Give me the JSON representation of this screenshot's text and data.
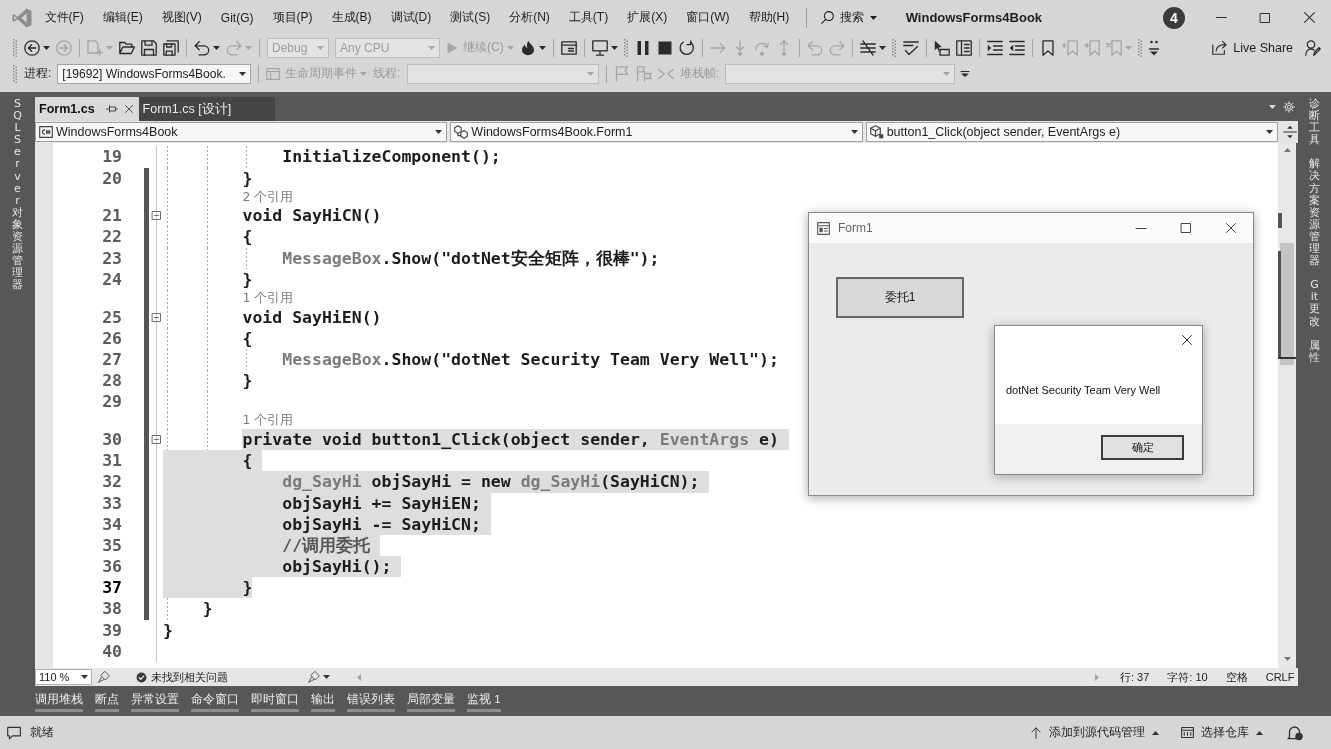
{
  "title_bar": {
    "menu": [
      "文件(F)",
      "编辑(E)",
      "视图(V)",
      "Git(G)",
      "项目(P)",
      "生成(B)",
      "调试(D)",
      "测试(S)",
      "分析(N)",
      "工具(T)",
      "扩展(X)",
      "窗口(W)",
      "帮助(H)"
    ],
    "search": "搜索",
    "title": "WindowsForms4Book",
    "account": "4"
  },
  "toolbar_rows": [
    [
      [
        [
          {
            "kind": "back",
            "disabled": false,
            "menu": true
          },
          {
            "kind": "forward",
            "disabled": true,
            "menu": false
          }
        ],
        [
          {
            "kind": "new_item",
            "disabled": true,
            "menu": true
          },
          {
            "kind": "open",
            "disabled": false,
            "menu": false
          },
          {
            "kind": "save",
            "disabled": false,
            "menu": false
          },
          {
            "kind": "save_all",
            "disabled": false,
            "menu": false
          }
        ],
        [
          {
            "kind": "undo",
            "disabled": false,
            "menu": true
          },
          {
            "kind": "redo",
            "disabled": true,
            "menu": true
          }
        ],
        [
          {
            "kind": "combo",
            "value": "Debug",
            "disabled": true
          },
          {
            "kind": "combo",
            "value": "Any CPU",
            "disabled": true
          },
          {
            "kind": "continue",
            "label": "继续(C)",
            "disabled": true,
            "menu": true
          },
          {
            "kind": "flame",
            "disabled": false,
            "menu": true
          }
        ],
        [
          {
            "kind": "browser",
            "disabled": false,
            "menu": false
          }
        ],
        [
          {
            "kind": "screen",
            "disabled": false,
            "menu": true
          }
        ]
      ],
      [
        [
          {
            "kind": "pause",
            "disabled": false,
            "menu": false
          },
          {
            "kind": "stop",
            "disabled": false,
            "menu": false
          },
          {
            "kind": "restart",
            "disabled": false,
            "menu": false
          }
        ],
        [
          {
            "kind": "next_statement",
            "disabled": true,
            "menu": false
          },
          {
            "kind": "step_into",
            "disabled": true,
            "menu": false
          },
          {
            "kind": "step_over",
            "disabled": true,
            "menu": false
          },
          {
            "kind": "step_out",
            "disabled": true,
            "menu": false
          }
        ],
        [
          {
            "kind": "curve_left",
            "disabled": true,
            "menu": false
          },
          {
            "kind": "curve_right",
            "disabled": true,
            "menu": false
          }
        ],
        [
          {
            "kind": "crossed",
            "disabled": false,
            "menu": true
          }
        ]
      ],
      [
        [
          {
            "kind": "spell",
            "disabled": false,
            "menu": false
          }
        ],
        [
          {
            "kind": "pointer",
            "disabled": false,
            "menu": false
          },
          {
            "kind": "panel",
            "disabled": false,
            "menu": false
          }
        ],
        [
          {
            "kind": "indent",
            "disabled": false,
            "menu": false
          },
          {
            "kind": "outdent",
            "disabled": false,
            "menu": false
          }
        ],
        [
          {
            "kind": "bookmark",
            "disabled": false,
            "menu": false
          },
          {
            "kind": "bookmark_prev",
            "disabled": true,
            "menu": false
          },
          {
            "kind": "bookmark_next",
            "disabled": true,
            "menu": false
          },
          {
            "kind": "bookmark_clear",
            "disabled": true,
            "menu": true
          }
        ]
      ],
      [
        [
          {
            "kind": "overflow",
            "disabled": false,
            "menu": false
          }
        ]
      ]
    ],
    [
      [
        [
          {
            "kind": "label",
            "text": "进程:",
            "disabled": false
          },
          {
            "kind": "combo",
            "value": "[19692] WindowsForms4Book.",
            "disabled": false
          }
        ],
        [
          {
            "kind": "events",
            "label": "生命周期事件",
            "disabled": true,
            "menu": true
          },
          {
            "kind": "label",
            "text": "线程:",
            "disabled": true
          },
          {
            "kind": "combo",
            "disabled": true
          }
        ],
        [
          {
            "kind": "flag",
            "disabled": true,
            "menu": false
          },
          {
            "kind": "flags",
            "disabled": true,
            "menu": false
          },
          {
            "kind": "threads",
            "disabled": true,
            "menu": false
          },
          {
            "kind": "label",
            "text": "堆栈帧:",
            "disabled": true
          },
          {
            "kind": "combo",
            "disabled": true
          },
          {
            "kind": "overflow_caret",
            "disabled": false,
            "menu": false
          }
        ]
      ]
    ]
  ],
  "live_share": "Live Share",
  "left_side_tabs": [
    "SQL Server 对象资源管理器"
  ],
  "document_tabs": [
    {
      "label": "Form1.cs",
      "selected": true
    },
    {
      "label": "Form1.cs [设计]",
      "selected": false
    }
  ],
  "navigation_bar": [
    {
      "kind": "project",
      "value": "WindowsForms4Book"
    },
    {
      "kind": "class",
      "value": "WindowsForms4Book.Form1"
    },
    {
      "kind": "method",
      "value": "button1_Click(object sender, EventArgs e)"
    }
  ],
  "editor": {
    "lines": [
      {
        "number": "19",
        "tokens": [
          {
            "kind": "plain",
            "text": "            InitializeComponent();"
          }
        ],
        "selected": false,
        "changed": false,
        "current": false,
        "foldable": false
      },
      {
        "number": "20",
        "tokens": [
          {
            "kind": "plain",
            "text": "        }"
          }
        ],
        "selected": false,
        "changed": true,
        "current": false,
        "foldable": false
      },
      {
        "number": "21",
        "references": "2 个引用",
        "tokens": [
          {
            "kind": "plain",
            "text": "        void SayHiCN()"
          }
        ],
        "selected": false,
        "changed": true,
        "current": false,
        "foldable": true,
        "expanded": true
      },
      {
        "number": "22",
        "tokens": [
          {
            "kind": "plain",
            "text": "        {"
          }
        ],
        "selected": false,
        "changed": true,
        "current": false,
        "foldable": false
      },
      {
        "number": "23",
        "tokens": [
          {
            "kind": "type",
            "text": "            MessageBox"
          },
          {
            "kind": "plain",
            "text": ".Show(\"dotNet安全矩阵，很棒\");"
          }
        ],
        "selected": false,
        "changed": true,
        "current": false,
        "foldable": false
      },
      {
        "number": "24",
        "tokens": [
          {
            "kind": "plain",
            "text": "        }"
          }
        ],
        "selected": false,
        "changed": true,
        "current": false,
        "foldable": false
      },
      {
        "number": "25",
        "references": "1 个引用",
        "tokens": [
          {
            "kind": "plain",
            "text": "        void SayHiEN()"
          }
        ],
        "selected": false,
        "changed": true,
        "current": false,
        "foldable": true,
        "expanded": true
      },
      {
        "number": "26",
        "tokens": [
          {
            "kind": "plain",
            "text": "        {"
          }
        ],
        "selected": false,
        "changed": true,
        "current": false,
        "foldable": false
      },
      {
        "number": "27",
        "tokens": [
          {
            "kind": "type",
            "text": "            MessageBox"
          },
          {
            "kind": "plain",
            "text": ".Show(\"dotNet Security Team Very Well\");"
          }
        ],
        "selected": false,
        "changed": true,
        "current": false,
        "foldable": false
      },
      {
        "number": "28",
        "tokens": [
          {
            "kind": "plain",
            "text": "        }"
          }
        ],
        "selected": false,
        "changed": true,
        "current": false,
        "foldable": false
      },
      {
        "number": "29",
        "selected": false,
        "changed": true,
        "current": false,
        "foldable": false
      },
      {
        "number": "30",
        "references": "1 个引用",
        "tokens": [
          {
            "kind": "plain",
            "text": "        private void button1_Click(object sender, "
          },
          {
            "kind": "type",
            "text": "EventArgs"
          },
          {
            "kind": "plain",
            "text": " e)"
          }
        ],
        "selected": true,
        "changed": true,
        "current": false,
        "foldable": true,
        "expanded": true
      },
      {
        "number": "31",
        "tokens": [
          {
            "kind": "plain",
            "text": "        {"
          }
        ],
        "selected": true,
        "changed": true,
        "current": false,
        "foldable": false
      },
      {
        "number": "32",
        "tokens": [
          {
            "kind": "type",
            "text": "            dg_SayHi"
          },
          {
            "kind": "plain",
            "text": " objSayHi = new "
          },
          {
            "kind": "type",
            "text": "dg_SayHi"
          },
          {
            "kind": "plain",
            "text": "(SayHiCN);"
          }
        ],
        "selected": true,
        "changed": true,
        "current": false,
        "foldable": false
      },
      {
        "number": "33",
        "tokens": [
          {
            "kind": "plain",
            "text": "            objSayHi += SayHiEN;"
          }
        ],
        "selected": true,
        "changed": true,
        "current": false,
        "foldable": false
      },
      {
        "number": "34",
        "tokens": [
          {
            "kind": "plain",
            "text": "            objSayHi -= SayHiCN;"
          }
        ],
        "selected": true,
        "changed": true,
        "current": false,
        "foldable": false
      },
      {
        "number": "35",
        "tokens": [
          {
            "kind": "comment",
            "text": "            //调用委托"
          }
        ],
        "selected": true,
        "changed": true,
        "current": false,
        "foldable": false
      },
      {
        "number": "36",
        "tokens": [
          {
            "kind": "plain",
            "text": "            objSayHi();"
          }
        ],
        "selected": true,
        "changed": true,
        "current": false,
        "foldable": false
      },
      {
        "number": "37",
        "tokens": [
          {
            "kind": "plain",
            "text": "        }"
          }
        ],
        "selected": true,
        "changed": true,
        "current": true,
        "foldable": false
      },
      {
        "number": "38",
        "tokens": [
          {
            "kind": "plain",
            "text": "    }"
          }
        ],
        "selected": false,
        "changed": true,
        "current": false,
        "foldable": false
      },
      {
        "number": "39",
        "tokens": [
          {
            "kind": "plain",
            "text": "}"
          }
        ],
        "selected": false,
        "changed": false,
        "current": false,
        "foldable": false
      },
      {
        "number": "40",
        "selected": false,
        "changed": false,
        "current": false,
        "foldable": false
      }
    ]
  },
  "form_window": {
    "title": "Form1",
    "button": "委托1",
    "message_box": {
      "message": "dotNet Security Team Very Well",
      "button": "确定"
    }
  },
  "right_side_tabs": [
    "诊断工具",
    "解决方案资源管理器",
    "Git 更改",
    "属性"
  ],
  "editor_status": {
    "zoom": "110 %",
    "issues": "未找到相关问题",
    "line": "行: 37",
    "column": "字符: 10",
    "indentation": "空格",
    "line_ending": "CRLF"
  },
  "tool_window_tabs": [
    "调用堆栈",
    "断点",
    "异常设置",
    "命令窗口",
    "即时窗口",
    "输出",
    "错误列表",
    "局部变量",
    "监视 1"
  ],
  "status_bar": {
    "status": "就绪",
    "source_control": "添加到源代码管理",
    "repository": "选择仓库"
  }
}
